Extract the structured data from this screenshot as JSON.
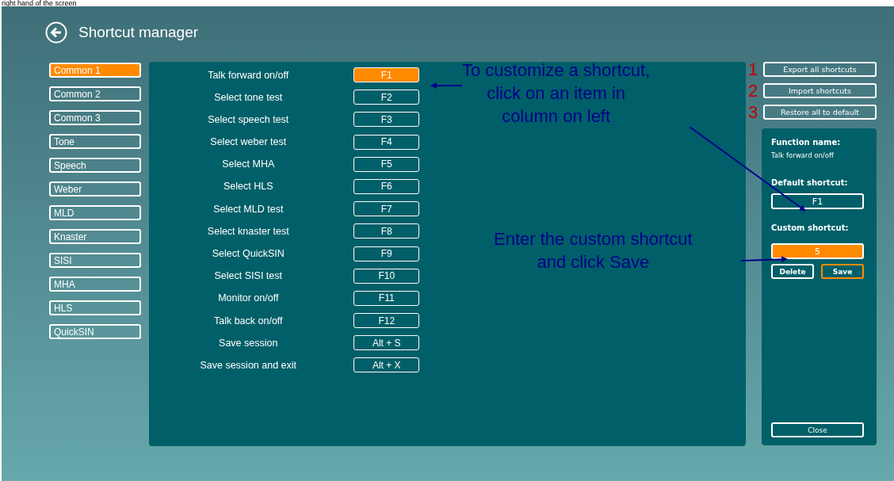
{
  "caption": "right hand of the screen",
  "header": {
    "title": "Shortcut manager"
  },
  "categories": [
    {
      "label": "Common 1",
      "selected": true
    },
    {
      "label": "Common 2",
      "selected": false
    },
    {
      "label": "Common 3",
      "selected": false
    },
    {
      "label": "Tone",
      "selected": false
    },
    {
      "label": "Speech",
      "selected": false
    },
    {
      "label": "Weber",
      "selected": false
    },
    {
      "label": "MLD",
      "selected": false
    },
    {
      "label": "Knaster",
      "selected": false
    },
    {
      "label": "SISI",
      "selected": false
    },
    {
      "label": "MHA",
      "selected": false
    },
    {
      "label": "HLS",
      "selected": false
    },
    {
      "label": "QuickSIN",
      "selected": false
    }
  ],
  "shortcuts": [
    {
      "function": "Talk forward on/off",
      "key": "F1",
      "selected": true
    },
    {
      "function": "Select tone test",
      "key": "F2",
      "selected": false
    },
    {
      "function": "Select speech test",
      "key": "F3",
      "selected": false
    },
    {
      "function": "Select weber test",
      "key": "F4",
      "selected": false
    },
    {
      "function": "Select MHA",
      "key": "F5",
      "selected": false
    },
    {
      "function": "Select HLS",
      "key": "F6",
      "selected": false
    },
    {
      "function": "Select MLD test",
      "key": "F7",
      "selected": false
    },
    {
      "function": "Select knaster test",
      "key": "F8",
      "selected": false
    },
    {
      "function": "Select QuickSIN",
      "key": "F9",
      "selected": false
    },
    {
      "function": "Select SISI test",
      "key": "F10",
      "selected": false
    },
    {
      "function": "Monitor on/off",
      "key": "F11",
      "selected": false
    },
    {
      "function": "Talk back on/off",
      "key": "F12",
      "selected": false
    },
    {
      "function": "Save session",
      "key": "Alt + S",
      "selected": false
    },
    {
      "function": "Save session and exit",
      "key": "Alt + X",
      "selected": false
    }
  ],
  "actions": [
    {
      "number": "1",
      "label": "Export all shortcuts"
    },
    {
      "number": "2",
      "label": "Import shortcuts"
    },
    {
      "number": "3",
      "label": "Restore all to default"
    }
  ],
  "details": {
    "function_label": "Function name:",
    "function_value": "Talk forward on/off",
    "default_label": "Default shortcut:",
    "default_value": "F1",
    "custom_label": "Custom shortcut:",
    "custom_value": "5",
    "delete": "Delete",
    "save": "Save",
    "close": "Close"
  },
  "annotations": [
    {
      "lines": [
        "To customize a shortcut,",
        "click on an item in",
        "column on left"
      ]
    },
    {
      "lines": [
        "Enter the custom shortcut",
        "and click Save"
      ]
    }
  ]
}
